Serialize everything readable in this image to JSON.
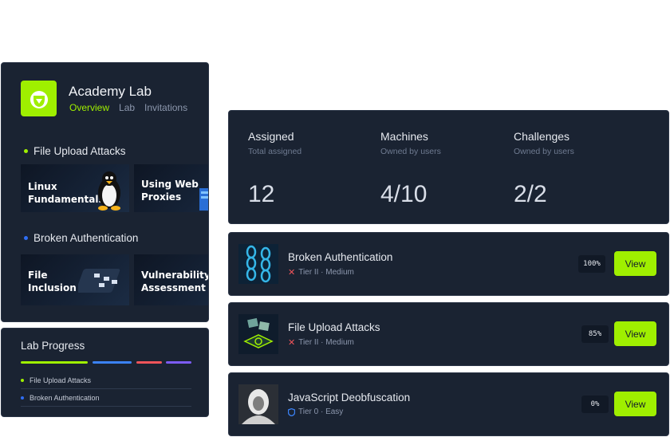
{
  "lab": {
    "title": "Academy Lab",
    "tabs": [
      "Overview",
      "Lab",
      "Invitations"
    ],
    "sections": [
      {
        "name": "File Upload Attacks",
        "dot_color": "#9fef00",
        "tiles": [
          "Linux\nFundamentals",
          "Using Web\nProxies"
        ]
      },
      {
        "name": "Broken Authentication",
        "dot_color": "#2f6ef5",
        "tiles": [
          "File\nInclusion",
          "Vulnerability\nAssessment"
        ]
      }
    ]
  },
  "progress": {
    "title": "Lab Progress",
    "bar_colors": [
      "#9fef00",
      "#3b82f6",
      "#f0545a",
      "#7c5cf5"
    ],
    "items": [
      {
        "label": "File Upload Attacks",
        "dot_color": "#9fef00"
      },
      {
        "label": "Broken Authentication",
        "dot_color": "#2f6ef5"
      }
    ]
  },
  "stats": [
    {
      "title": "Assigned",
      "subtitle": "Total assigned",
      "value": "12"
    },
    {
      "title": "Machines",
      "subtitle": "Owned by users",
      "value": "4/10"
    },
    {
      "title": "Challenges",
      "subtitle": "Owned by users",
      "value": "2/2"
    }
  ],
  "modules": [
    {
      "title": "Broken Authentication",
      "meta": "Tier II · Medium",
      "meta_icon": "x-mark-icon",
      "progress": "100%",
      "button": "View"
    },
    {
      "title": "File Upload Attacks",
      "meta": "Tier II · Medium",
      "meta_icon": "x-mark-icon",
      "progress": "85%",
      "button": "View"
    },
    {
      "title": "JavaScript Deobfuscation",
      "meta": "Tier 0 · Easy",
      "meta_icon": "shield-icon",
      "progress": "0%",
      "button": "View"
    }
  ],
  "colors": {
    "accent": "#9fef00",
    "card_bg": "#1a2332",
    "danger": "#f0545a",
    "info": "#2f6ef5"
  }
}
